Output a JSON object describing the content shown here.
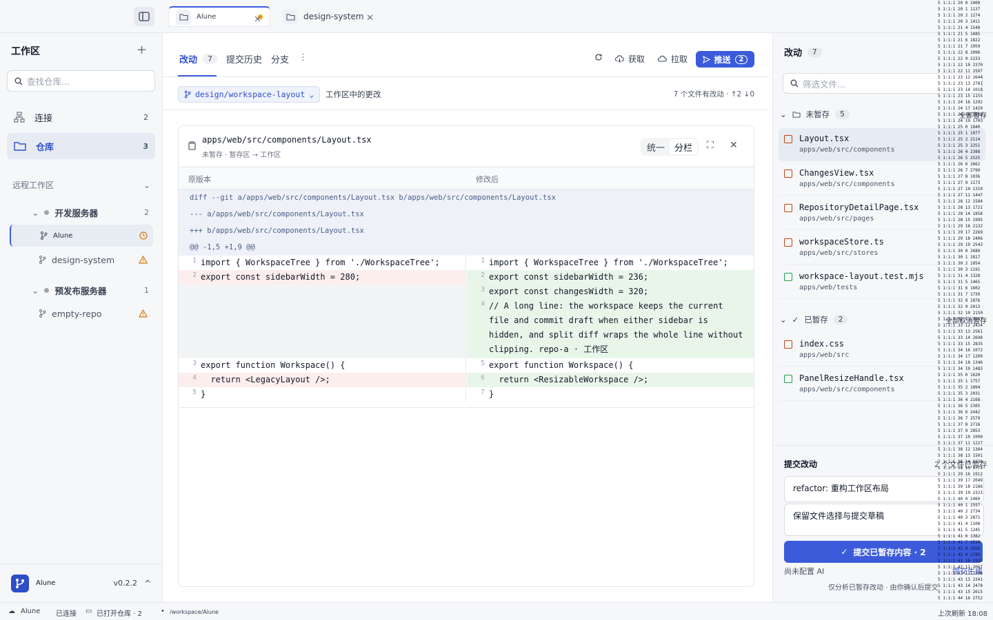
{
  "topbar": {
    "tabs": [
      {
        "label": "Alune",
        "dirty": true
      },
      {
        "label": "design-system",
        "dirty": false
      }
    ]
  },
  "sidebar": {
    "title": "工作区",
    "search_placeholder": "查找仓库...",
    "nav": [
      {
        "label": "连接",
        "count": "2",
        "icon": "connection-icon"
      },
      {
        "label": "仓库",
        "count": "3",
        "icon": "folder-icon"
      }
    ],
    "section_label": "远程工作区",
    "servers": [
      {
        "name": "开发服务器",
        "count": "2",
        "repos": [
          {
            "name": "Alune",
            "status": "clock-icon"
          },
          {
            "name": "design-system",
            "status": "warning-icon"
          }
        ]
      },
      {
        "name": "预发布服务器",
        "count": "1",
        "repos": [
          {
            "name": "empty-repo",
            "status": "warning-icon"
          }
        ]
      }
    ],
    "footer": {
      "app_name": "Alune",
      "version": "v0.2.2"
    }
  },
  "center": {
    "tabs": [
      {
        "label": "改动",
        "count": "7"
      },
      {
        "label": "提交历史"
      },
      {
        "label": "分支"
      }
    ],
    "actions": {
      "fetch": "获取",
      "pull": "拉取",
      "push": "推送",
      "push_count": "2"
    },
    "branch": "design/workspace-layout",
    "sub_label": "工作区中的更改",
    "sub_stat": "7 个文件有改动 · ↑2 ↓0",
    "diff": {
      "file_path": "apps/web/src/components/Layout.tsx",
      "file_sub": "未暂存 · 暂存区 → 工作区",
      "view_unified": "统一",
      "view_split": "分栏",
      "col_left": "原版本",
      "col_right": "修改后",
      "meta": [
        "diff --git a/apps/web/src/components/Layout.tsx b/apps/web/src/components/Layout.tsx",
        "--- a/apps/web/src/components/Layout.tsx",
        "+++ b/apps/web/src/components/Layout.tsx",
        "@@ -1,5 +1,9 @@"
      ],
      "left_lines": [
        {
          "n": "1",
          "code": "import { WorkspaceTree } from './WorkspaceTree';",
          "kind": "ctx"
        },
        {
          "n": "2",
          "code": "export const sidebarWidth = 280;",
          "kind": "del"
        },
        {
          "n": "",
          "code": "",
          "kind": "empty"
        },
        {
          "n": "",
          "code": "",
          "kind": "empty"
        },
        {
          "n": "3",
          "code": "export function Workspace() {",
          "kind": "ctx"
        },
        {
          "n": "4",
          "code": "  return <LegacyLayout />;",
          "kind": "del"
        },
        {
          "n": "5",
          "code": "}",
          "kind": "ctx"
        }
      ],
      "right_lines": [
        {
          "n": "1",
          "code": "import { WorkspaceTree } from './WorkspaceTree';",
          "kind": "ctx"
        },
        {
          "n": "2",
          "code": "export const sidebarWidth = 236;",
          "kind": "add"
        },
        {
          "n": "3",
          "code": "export const changesWidth = 320;",
          "kind": "add"
        },
        {
          "n": "4",
          "code": "// A long line: the workspace keeps the current file and commit draft when either sidebar is hidden, and split diff wraps the whole line without clipping. repo-a · 工作区",
          "kind": "add"
        },
        {
          "n": "5",
          "code": "export function Workspace() {",
          "kind": "ctx"
        },
        {
          "n": "6",
          "code": "  return <ResizableWorkspace />;",
          "kind": "add"
        },
        {
          "n": "7",
          "code": "}",
          "kind": "ctx"
        }
      ]
    }
  },
  "changes": {
    "title": "改动",
    "count": "7",
    "filter_placeholder": "筛选文件...",
    "unstaged": {
      "label": "未暂存",
      "count": "5",
      "action": "全部暂存",
      "files": [
        {
          "name": "Layout.tsx",
          "path": "apps/web/src/components"
        },
        {
          "name": "ChangesView.tsx",
          "path": "apps/web/src/components"
        },
        {
          "name": "RepositoryDetailPage.tsx",
          "path": "apps/web/src/pages"
        },
        {
          "name": "workspaceStore.ts",
          "path": "apps/web/src/stores"
        },
        {
          "name": "workspace-layout.test.mjs",
          "path": "apps/web/tests"
        }
      ]
    },
    "staged": {
      "label": "已暂存",
      "count": "2",
      "action": "全部取消暂存",
      "files": [
        {
          "name": "index.css",
          "path": "apps/web/src"
        },
        {
          "name": "PanelResizeHandle.tsx",
          "path": "apps/web/src/components"
        }
      ]
    },
    "commit": {
      "title": "提交改动",
      "hint": "2 个文件已暂存",
      "summary": "refactor: 重构工作区布局",
      "description": "保留文件选择与提交草稿",
      "button": "提交已暂存内容 · 2",
      "ai_status": "尚未配置 AI",
      "ai_action": "提交生成",
      "note": "仅分析已暂存改动 · 由你确认后提交"
    }
  },
  "statusbar": {
    "app": "Alune",
    "connection": "已连接",
    "repos": "已打开仓库 · 2",
    "path": "/workspace/Alune",
    "refresh": "上次刷新 18:08"
  },
  "colors": {
    "accent": "#3b5bdb",
    "add_bg": "#e8f6ea",
    "del_bg": "#fdeeee",
    "warning": "#d97706"
  }
}
